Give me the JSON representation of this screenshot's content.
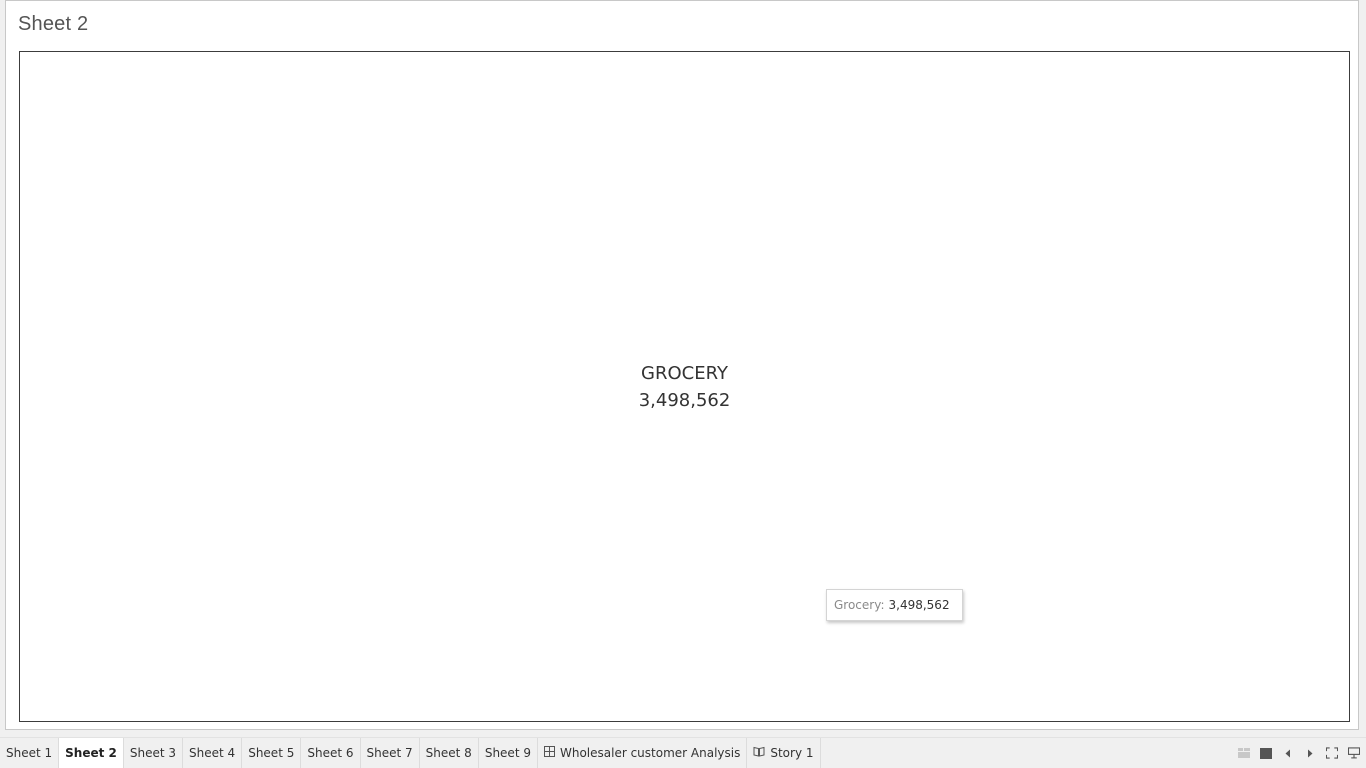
{
  "sheet": {
    "title": "Sheet 2"
  },
  "treemap": {
    "category": "GROCERY",
    "value": "3,498,562"
  },
  "tooltip": {
    "label": "Grocery:",
    "value": "3,498,562"
  },
  "tabs": [
    {
      "label": "Sheet 1",
      "active": false
    },
    {
      "label": "Sheet 2",
      "active": true
    },
    {
      "label": "Sheet 3",
      "active": false
    },
    {
      "label": "Sheet 4",
      "active": false
    },
    {
      "label": "Sheet 5",
      "active": false
    },
    {
      "label": "Sheet 6",
      "active": false
    },
    {
      "label": "Sheet 7",
      "active": false
    },
    {
      "label": "Sheet 8",
      "active": false
    },
    {
      "label": "Sheet 9",
      "active": false
    },
    {
      "label": "Wholesaler customer Analysis",
      "active": false,
      "icon": "dashboard-icon"
    },
    {
      "label": "Story 1",
      "active": false,
      "icon": "story-icon"
    }
  ],
  "controls": [
    {
      "icon": "show-tabs-icon"
    },
    {
      "icon": "show-filmstrip-icon"
    },
    {
      "icon": "previous-sheet-icon"
    },
    {
      "icon": "next-sheet-icon"
    },
    {
      "icon": "fullscreen-icon"
    },
    {
      "icon": "presentation-mode-icon"
    }
  ],
  "colors": {
    "frame_background": "#ffffff",
    "tab_bar_background": "#f0f0f0",
    "text": "#333333",
    "tooltip_label": "#8a8a8a"
  }
}
